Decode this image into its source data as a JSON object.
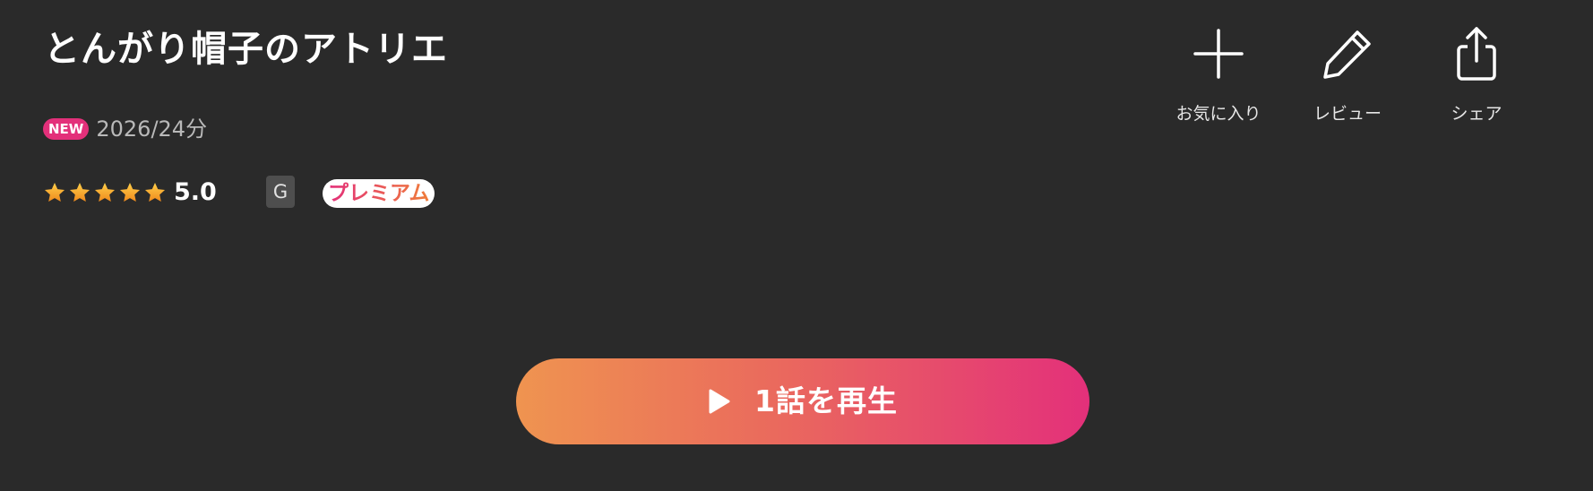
{
  "title": "とんがり帽子のアトリエ",
  "meta": {
    "new_badge": "NEW",
    "year_duration": "2026/24分"
  },
  "rating": {
    "stars": 5,
    "value": "5.0"
  },
  "age_rating": "G",
  "premium_label": "プレミアム",
  "actions": {
    "favorite": {
      "label": "お気に入り",
      "icon": "plus-icon"
    },
    "review": {
      "label": "レビュー",
      "icon": "pencil-icon"
    },
    "share": {
      "label": "シェア",
      "icon": "share-icon"
    }
  },
  "play_button": {
    "label": "1話を再生",
    "icon": "play-icon"
  },
  "colors": {
    "background": "#2a2a2a",
    "accent_pink": "#e3307a",
    "accent_orange": "#ef9450",
    "star_gold": "#f5a623",
    "badge_gray": "#4e4e4e"
  }
}
